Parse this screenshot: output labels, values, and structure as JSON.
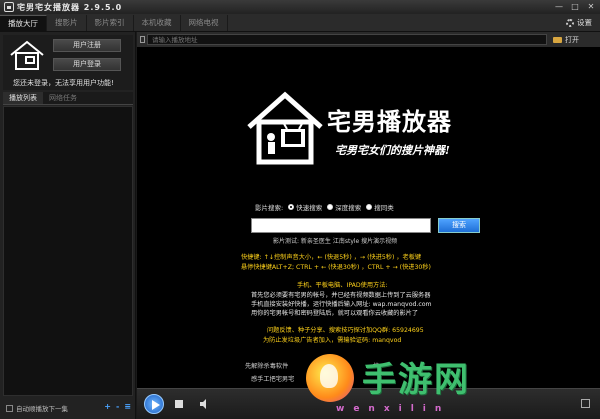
{
  "window": {
    "title": "宅男宅女播放器 2.9.5.0",
    "controls": [
      "—",
      "□",
      "✕"
    ]
  },
  "tabs": [
    {
      "label": "播放大厅",
      "active": true
    },
    {
      "label": "搜影片",
      "active": false
    },
    {
      "label": "影片索引",
      "active": false
    },
    {
      "label": "本机收藏",
      "active": false
    },
    {
      "label": "网络电视",
      "active": false
    }
  ],
  "settings_label": "设置",
  "login": {
    "register_label": "用户注册",
    "login_label": "用户登录",
    "tip": "您还未登录，无法享用用户功能!"
  },
  "subtabs": [
    {
      "label": "播放列表",
      "active": true
    },
    {
      "label": "网络任务",
      "active": false
    }
  ],
  "left_footer": {
    "auto_play_label": "自动顺播放下一集",
    "buttons": [
      "+",
      "-",
      "≡"
    ]
  },
  "address": {
    "placeholder": "请输入播放地址",
    "open_label": "打开"
  },
  "screen": {
    "logo_title": "宅男播放器",
    "logo_slogan": "宅男宅女们的搜片神器!",
    "search_label": "影片搜索:",
    "search_options": [
      {
        "label": "快速搜索",
        "checked": true
      },
      {
        "label": "深度搜索",
        "checked": false
      },
      {
        "label": "搜同类",
        "checked": false
      }
    ],
    "search_button": "搜索",
    "test_line": "影片测试:  新亲圣医生    江南style    搜片演示视频",
    "hotkeys": [
      "快捷键: ↑↓控制声音大小，← (快退5秒) ，→ (快进5秒) ，老板键",
      "悬停快捷键ALT+Z; CTRL + ← (快退30秒) ，CTRL + → (快进30秒)"
    ],
    "mobile_title": "手机、平板电脑、IPAD使用方法:",
    "mobile_lines": [
      "首先您必须要有宅男的帐号，并已经有视频数据上传到了云服务器",
      "手机直接安装好快播，运行快播后输入网址: wap.manqvod.com",
      "用你的宅男帐号和密码登陆后，就可以观看你云收藏的影片了"
    ],
    "feedback_lines": [
      "问题反馈、种子分享、搜索技巧探讨加QQ群: 65924695",
      "为防止发垃圾广告者加入，需输验证码: manqvod"
    ],
    "obscured_lines": [
      "先解除杀毒软件",
      "感手工把宅男宅"
    ],
    "obscured_fragment": "按"
  },
  "watermark": {
    "text": "手游网",
    "url": "wenxilin"
  }
}
